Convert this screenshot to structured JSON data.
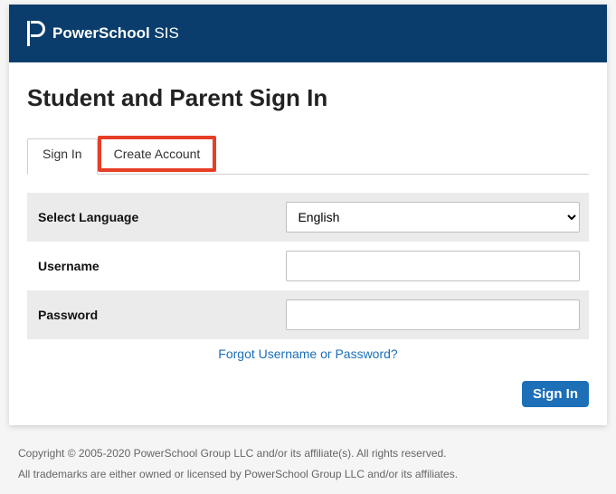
{
  "header": {
    "brand_prefix": "PowerSchool",
    "brand_suffix": " SIS"
  },
  "page_title": "Student and Parent Sign In",
  "tabs": {
    "sign_in": "Sign In",
    "create_account": "Create Account"
  },
  "form": {
    "language_label": "Select Language",
    "language_value": "English",
    "username_label": "Username",
    "username_value": "",
    "password_label": "Password",
    "password_value": ""
  },
  "forgot_link": "Forgot Username or Password?",
  "signin_button": "Sign In",
  "footer": {
    "line1": "Copyright © 2005-2020 PowerSchool Group LLC and/or its affiliate(s). All rights reserved.",
    "line2": "All trademarks are either owned or licensed by PowerSchool Group LLC and/or its affiliates."
  }
}
